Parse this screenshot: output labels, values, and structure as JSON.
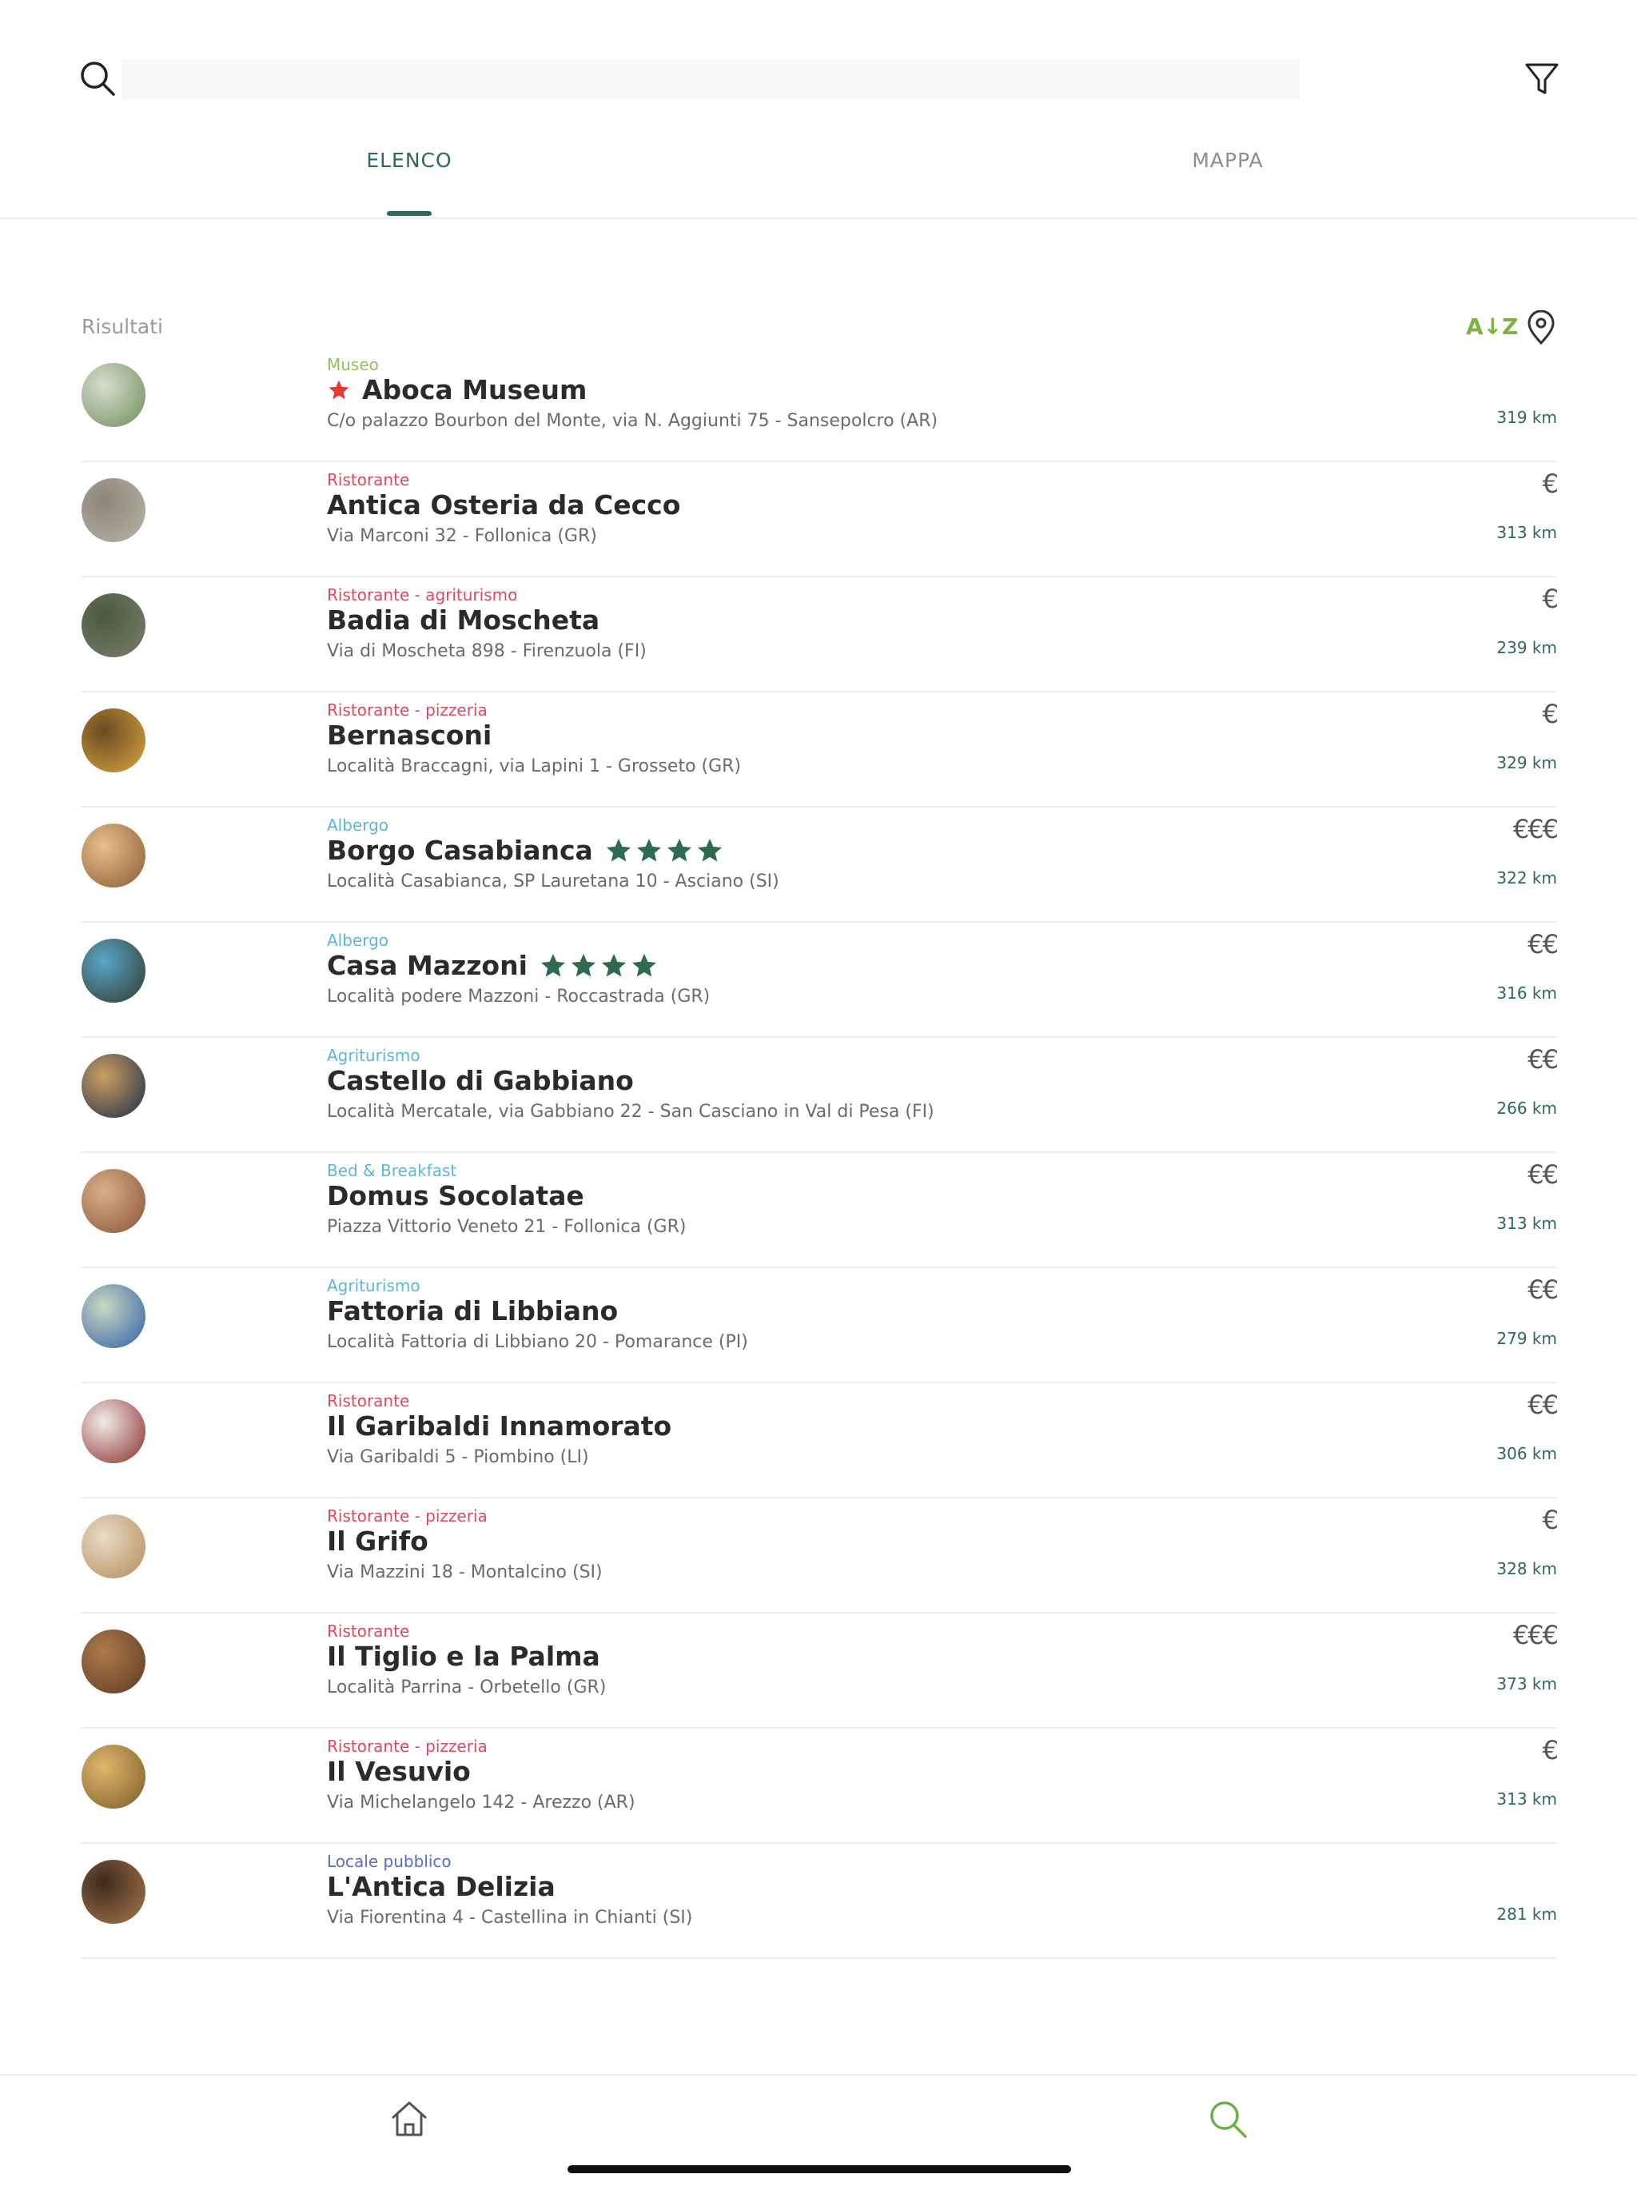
{
  "search": {
    "placeholder": "",
    "value": ""
  },
  "tabs": {
    "list": "ELENCO",
    "map": "MAPPA",
    "active": "list"
  },
  "results": {
    "label": "Risultati",
    "sort_label": "A↓Z"
  },
  "colors": {
    "brand_green": "#2d6a4f",
    "light_green": "#7cb342",
    "ristorante": "#e0485f",
    "albergo": "#5fb6d6",
    "museo": "#8fc25a",
    "locale": "#5d6bc4"
  },
  "items": [
    {
      "category": "Museo",
      "category_color": "#8fc25a",
      "name": "Aboca Museum",
      "featured": true,
      "stars": 0,
      "address": "C/o palazzo Bourbon del Monte, via N. Aggiunti 75 - Sansepolcro (AR)",
      "price": "",
      "distance": "319 km",
      "thumb_colors": [
        "#6b8f5a",
        "#d9dccf"
      ]
    },
    {
      "category": "Ristorante",
      "category_color": "#e0485f",
      "name": "Antica Osteria da Cecco",
      "featured": false,
      "stars": 0,
      "address": "Via Marconi 32 - Follonica (GR)",
      "price": "€",
      "distance": "313 km",
      "thumb_colors": [
        "#b9b4a8",
        "#8c857a"
      ]
    },
    {
      "category": "Ristorante - agriturismo",
      "category_color": "#e0485f",
      "name": "Badia di Moscheta",
      "featured": false,
      "stars": 0,
      "address": "Via di Moscheta 898 - Firenzuola (FI)",
      "price": "€",
      "distance": "239 km",
      "thumb_colors": [
        "#7c7d6b",
        "#4a5a40"
      ]
    },
    {
      "category": "Ristorante - pizzeria",
      "category_color": "#e0485f",
      "name": "Bernasconi",
      "featured": false,
      "stars": 0,
      "address": "Località Braccagni, via Lapini 1 - Grosseto (GR)",
      "price": "€",
      "distance": "329 km",
      "thumb_colors": [
        "#d9a640",
        "#6b4a22"
      ]
    },
    {
      "category": "Albergo",
      "category_color": "#5fb6d6",
      "name": "Borgo Casabianca",
      "featured": false,
      "stars": 4,
      "address": "Località Casabianca, SP Lauretana 10 - Asciano (SI)",
      "price": "€€€",
      "distance": "322 km",
      "thumb_colors": [
        "#8a5a34",
        "#e8c08a"
      ]
    },
    {
      "category": "Albergo",
      "category_color": "#5fb6d6",
      "name": "Casa Mazzoni",
      "featured": false,
      "stars": 4,
      "address": "Località podere Mazzoni - Roccastrada (GR)",
      "price": "€€",
      "distance": "316 km",
      "thumb_colors": [
        "#2f3a2a",
        "#5aa5c9"
      ]
    },
    {
      "category": "Agriturismo",
      "category_color": "#5fb6d6",
      "name": "Castello di Gabbiano",
      "featured": false,
      "stars": 0,
      "address": "Località Mercatale, via Gabbiano 22 - San Casciano in Val di Pesa (FI)",
      "price": "€€",
      "distance": "266 km",
      "thumb_colors": [
        "#1d2a4a",
        "#caa060"
      ]
    },
    {
      "category": "Bed & Breakfast",
      "category_color": "#5fb6d6",
      "name": "Domus Socolatae",
      "featured": false,
      "stars": 0,
      "address": "Piazza Vittorio Veneto 21 - Follonica (GR)",
      "price": "€€",
      "distance": "313 km",
      "thumb_colors": [
        "#8a5236",
        "#d9b08a"
      ]
    },
    {
      "category": "Agriturismo",
      "category_color": "#5fb6d6",
      "name": "Fattoria di Libbiano",
      "featured": false,
      "stars": 0,
      "address": "Località Fattoria di Libbiano 20 - Pomarance (PI)",
      "price": "€€",
      "distance": "279 km",
      "thumb_colors": [
        "#2f5fa8",
        "#c9d8c0"
      ]
    },
    {
      "category": "Ristorante",
      "category_color": "#e0485f",
      "name": "Il Garibaldi Innamorato",
      "featured": false,
      "stars": 0,
      "address": "Via Garibaldi 5 - Piombino (LI)",
      "price": "€€",
      "distance": "306 km",
      "thumb_colors": [
        "#8a2a2a",
        "#f0ece6"
      ]
    },
    {
      "category": "Ristorante - pizzeria",
      "category_color": "#e0485f",
      "name": "Il Grifo",
      "featured": false,
      "stars": 0,
      "address": "Via Mazzini 18 - Montalcino (SI)",
      "price": "€",
      "distance": "328 km",
      "thumb_colors": [
        "#b58a5a",
        "#e9dcc6"
      ]
    },
    {
      "category": "Ristorante",
      "category_color": "#e0485f",
      "name": "Il Tiglio e la Palma",
      "featured": false,
      "stars": 0,
      "address": "Località Parrina - Orbetello (GR)",
      "price": "€€€",
      "distance": "373 km",
      "thumb_colors": [
        "#5a3a26",
        "#b07a4a"
      ]
    },
    {
      "category": "Ristorante - pizzeria",
      "category_color": "#e0485f",
      "name": "Il Vesuvio",
      "featured": false,
      "stars": 0,
      "address": "Via Michelangelo 142 - Arezzo (AR)",
      "price": "€",
      "distance": "313 km",
      "thumb_colors": [
        "#7a5a2a",
        "#e0b86a"
      ]
    },
    {
      "category": "Locale pubblico",
      "category_color": "#5d6bc4",
      "name": "L'Antica Delizia",
      "featured": false,
      "stars": 0,
      "address": "Via Fiorentina 4 - Castellina in Chianti (SI)",
      "price": "",
      "distance": "281 km",
      "thumb_colors": [
        "#a8774a",
        "#3e2a1e"
      ]
    }
  ],
  "bottom_nav": [
    {
      "icon": "home-icon",
      "active": false
    },
    {
      "icon": "search-icon",
      "active": true
    }
  ]
}
